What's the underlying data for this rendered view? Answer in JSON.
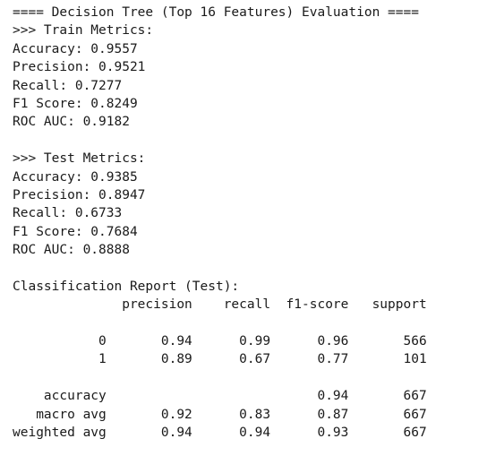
{
  "console": {
    "lines": [
      "==== Decision Tree (Top 16 Features) Evaluation ====",
      ">>> Train Metrics:",
      "Accuracy: 0.9557",
      "Precision: 0.9521",
      "Recall: 0.7277",
      "F1 Score: 0.8249",
      "ROC AUC: 0.9182",
      "",
      ">>> Test Metrics:",
      "Accuracy: 0.9385",
      "Precision: 0.8947",
      "Recall: 0.6733",
      "F1 Score: 0.7684",
      "ROC AUC: 0.8888",
      "",
      "Classification Report (Test):",
      "              precision    recall  f1-score   support",
      "",
      "           0       0.94      0.99      0.96       566",
      "           1       0.89      0.67      0.77       101",
      "",
      "    accuracy                           0.94       667",
      "   macro avg       0.92      0.83      0.87       667",
      "weighted avg       0.94      0.94      0.93       667"
    ]
  }
}
